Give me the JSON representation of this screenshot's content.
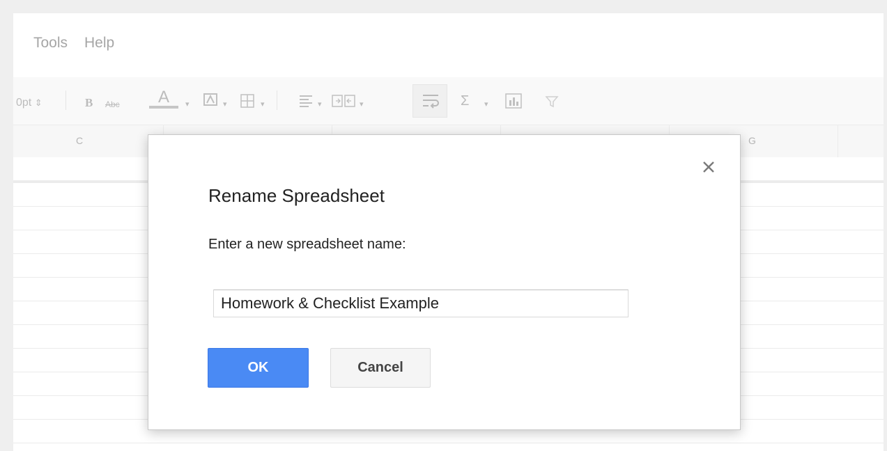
{
  "menu": {
    "items": [
      {
        "label": "Tools"
      },
      {
        "label": "Help"
      }
    ]
  },
  "toolbar": {
    "font_size": "0pt",
    "font_size_arrows": "⇕",
    "bold": "B",
    "strikethrough": "Abc",
    "text_color": "A",
    "icons": [
      "text-color-icon",
      "fill-color-icon",
      "borders-icon",
      "align-icon",
      "merge-icon",
      "wrap-icon",
      "sigma-icon",
      "chart-icon",
      "filter-icon"
    ]
  },
  "columns": {
    "c": "C",
    "g": "G"
  },
  "dialog": {
    "title": "Rename Spreadsheet",
    "prompt": "Enter a new spreadsheet name:",
    "input_value": "Homework & Checklist Example",
    "ok_label": "OK",
    "cancel_label": "Cancel",
    "close_glyph": "×"
  },
  "colors": {
    "ok_button": "#4a8af4",
    "cancel_button": "#f5f5f5"
  }
}
